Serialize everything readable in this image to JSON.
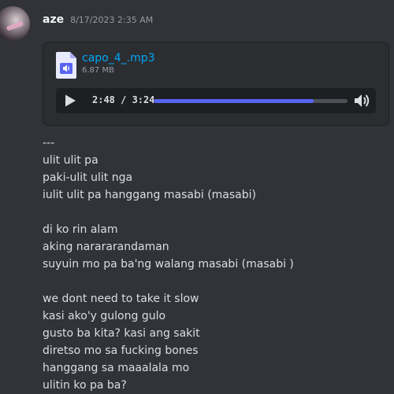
{
  "message": {
    "username": "aze",
    "timestamp": "8/17/2023 2:35 AM",
    "attachment": {
      "file_name": "capo_4_.mp3",
      "file_size": "6.87 MB",
      "file_icon": "audio-file-icon",
      "player": {
        "time": "2:48 / 3:24",
        "progress_fraction": 0.824,
        "play_icon": "play-icon",
        "volume_icon": "volume-icon"
      }
    },
    "lines": [
      "---",
      "ulit ulit pa",
      "paki-ulit ulit nga",
      "iulit ulit pa hanggang masabi (masabi)",
      "",
      "di ko rin alam",
      "aking narararandaman",
      "suyuin mo pa ba'ng walang masabi (masabi )",
      "",
      "we dont need to take it slow",
      "kasi ako'y gulong gulo",
      "gusto ba kita? kasi ang sakit",
      "diretso mo sa fucking bones",
      "hanggang sa maaalala mo",
      "ulitin ko pa ba?"
    ]
  },
  "colors": {
    "background": "#313338",
    "link": "#00a8fc",
    "accent": "#5865f2"
  }
}
